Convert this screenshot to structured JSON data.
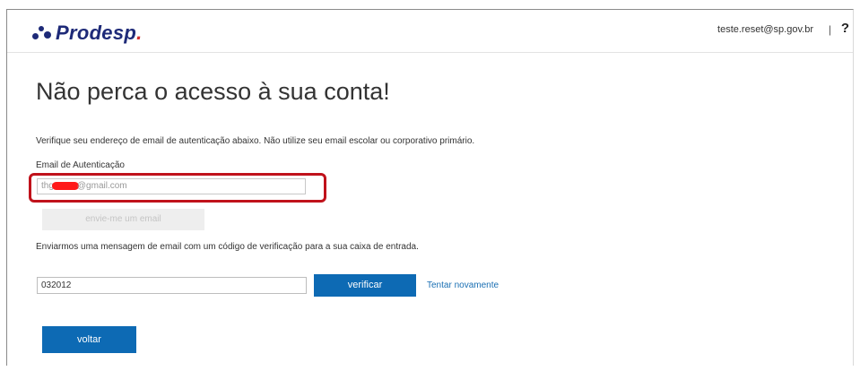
{
  "header": {
    "logo_text": "Prodesp",
    "logo_dot": ".",
    "user_email": "teste.reset@sp.gov.br",
    "separator": "|",
    "help_label": "?"
  },
  "main": {
    "title": "Não perca o acesso à sua conta!",
    "instructions": "Verifique seu endereço de email de autenticação abaixo. Não utilize seu email escolar ou corporativo primário.",
    "email_label": "Email de Autenticação",
    "email_value_prefix": "thg",
    "email_value_suffix": "@gmail.com",
    "send_button": "envie-me um email",
    "sent_message": "Enviarmos uma mensagem de email com um código de verificação para a sua caixa de entrada.",
    "code_value": "032012",
    "verify_button": "verificar",
    "retry_link": "Tentar novamente",
    "back_button": "voltar"
  },
  "colors": {
    "brand": "#1e2a78",
    "primary_button": "#0d6ab4",
    "link": "#1a6fb3",
    "highlight_border": "#c0121b",
    "redaction": "#ff1a1a"
  }
}
